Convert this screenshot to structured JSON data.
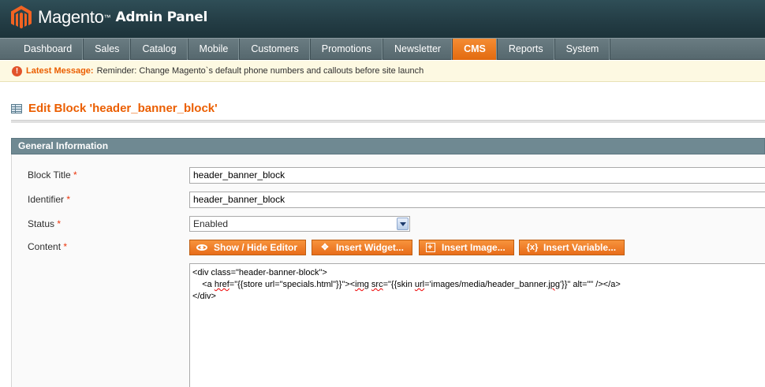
{
  "header": {
    "brand": "Magento",
    "tm": "™",
    "subtitle": "Admin Panel"
  },
  "nav": {
    "items": [
      "Dashboard",
      "Sales",
      "Catalog",
      "Mobile",
      "Customers",
      "Promotions",
      "Newsletter",
      "CMS",
      "Reports",
      "System"
    ],
    "active": "CMS"
  },
  "message": {
    "icon": "!",
    "label": "Latest Message:",
    "text": "Reminder: Change Magento`s default phone numbers and callouts before site launch"
  },
  "page": {
    "title": "Edit Block 'header_banner_block'"
  },
  "fieldset": {
    "title": "General Information"
  },
  "form": {
    "block_title_label": "Block Title",
    "block_title_value": "header_banner_block",
    "identifier_label": "Identifier",
    "identifier_value": "header_banner_block",
    "status_label": "Status",
    "status_value": "Enabled",
    "content_label": "Content",
    "required_mark": "*"
  },
  "buttons": {
    "show_hide_editor": "Show / Hide Editor",
    "insert_widget": "Insert Widget...",
    "insert_image": "Insert Image...",
    "insert_variable": "Insert Variable...",
    "variable_icon": "{x}"
  },
  "content": {
    "line1": "<div class=\"header-banner-block\">",
    "line2_a": "    <a ",
    "line2_b": "href",
    "line2_c": "=\"{{store url=\"specials.html\"}}\"><",
    "line2_d": "img",
    "line2_e": " ",
    "line2_f": "src",
    "line2_g": "=\"{{skin ",
    "line2_h": "url",
    "line2_i": "='images/media/header_banner.",
    "line2_j": "jpg",
    "line2_k": "'}}\" alt=\"\" /></a>",
    "line3": "</div>"
  }
}
